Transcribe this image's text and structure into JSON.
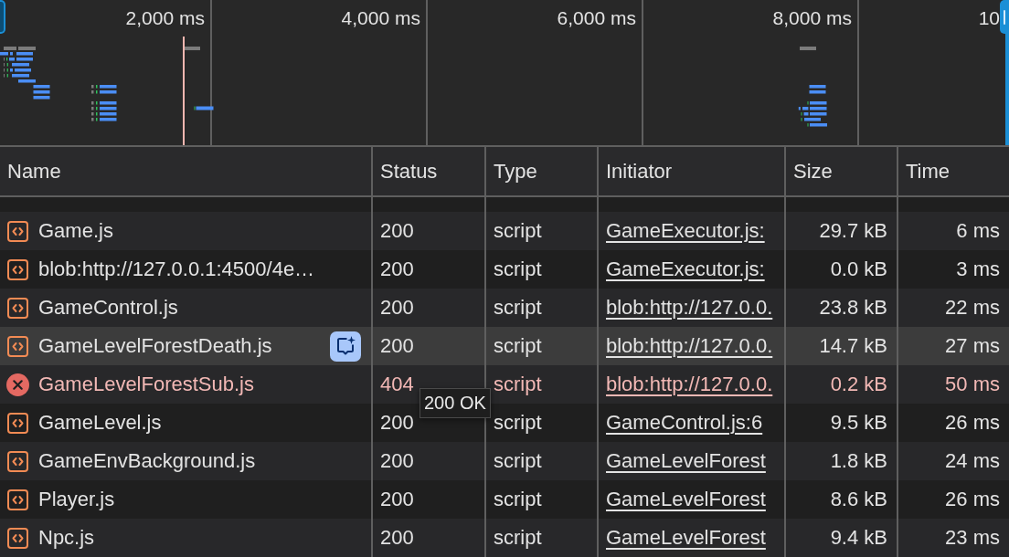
{
  "overview": {
    "time_labels": [
      "2,000 ms",
      "4,000 ms",
      "6,000 ms",
      "8,000 ms",
      "10"
    ]
  },
  "table": {
    "columns": [
      "Name",
      "Status",
      "Type",
      "Initiator",
      "Size",
      "Time"
    ],
    "rows": [
      {
        "name": "Game.js",
        "status": "200",
        "type": "script",
        "initiator": "GameExecutor.js:",
        "size": "29.7 kB",
        "time": "6 ms",
        "error": false,
        "hovered": false
      },
      {
        "name": "blob:http://127.0.0.1:4500/4e…",
        "status": "200",
        "type": "script",
        "initiator": "GameExecutor.js:",
        "size": "0.0 kB",
        "time": "3 ms",
        "error": false,
        "hovered": false
      },
      {
        "name": "GameControl.js",
        "status": "200",
        "type": "script",
        "initiator": "blob:http://127.0.0.",
        "size": "23.8 kB",
        "time": "22 ms",
        "error": false,
        "hovered": false
      },
      {
        "name": "GameLevelForestDeath.js",
        "status": "200",
        "type": "script",
        "initiator": "blob:http://127.0.0.",
        "size": "14.7 kB",
        "time": "27 ms",
        "error": false,
        "hovered": true
      },
      {
        "name": "GameLevelForestSub.js",
        "status": "404",
        "type": "script",
        "initiator": "blob:http://127.0.0.",
        "size": "0.2 kB",
        "time": "50 ms",
        "error": true,
        "hovered": false
      },
      {
        "name": "GameLevel.js",
        "status": "200",
        "type": "script",
        "initiator": "GameControl.js:6",
        "size": "9.5 kB",
        "time": "26 ms",
        "error": false,
        "hovered": false
      },
      {
        "name": "GameEnvBackground.js",
        "status": "200",
        "type": "script",
        "initiator": "GameLevelForest",
        "size": "1.8 kB",
        "time": "24 ms",
        "error": false,
        "hovered": false
      },
      {
        "name": "Player.js",
        "status": "200",
        "type": "script",
        "initiator": "GameLevelForest",
        "size": "8.6 kB",
        "time": "26 ms",
        "error": false,
        "hovered": false
      },
      {
        "name": "Npc.js",
        "status": "200",
        "type": "script",
        "initiator": "GameLevelForest",
        "size": "9.4 kB",
        "time": "23 ms",
        "error": false,
        "hovered": false
      }
    ]
  },
  "tooltip": "200 OK"
}
